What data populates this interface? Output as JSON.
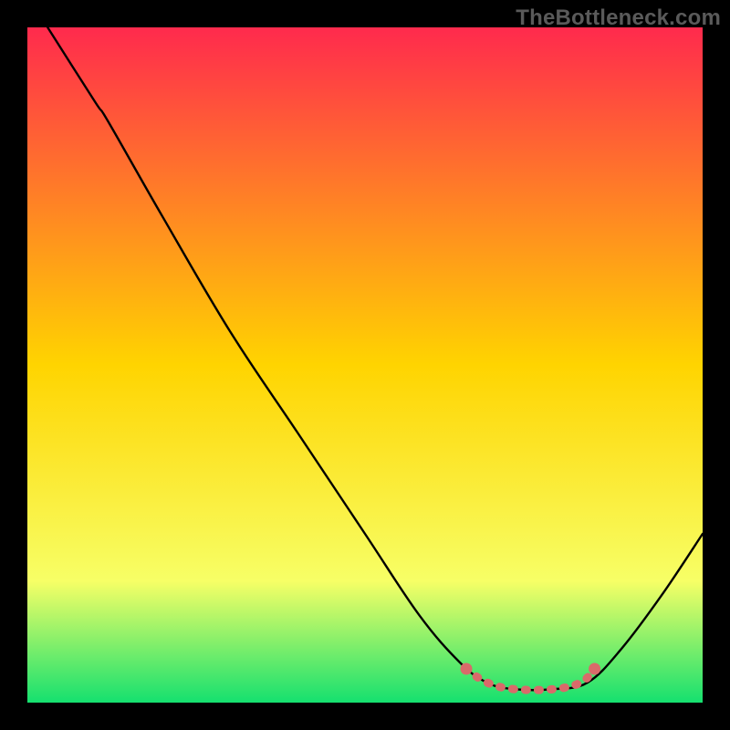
{
  "watermark": "TheBottleneck.com",
  "chart_data": {
    "type": "line",
    "title": "",
    "xlabel": "",
    "ylabel": "",
    "xlim": [
      0,
      100
    ],
    "ylim": [
      0,
      100
    ],
    "background_gradient": {
      "top_color": "#ff2a4d",
      "mid_color": "#ffd400",
      "low_color": "#f7ff66",
      "bottom_color": "#15e06f"
    },
    "series": [
      {
        "name": "bottleneck-curve",
        "color": "#000000",
        "points": [
          {
            "x": 3,
            "y": 100
          },
          {
            "x": 10,
            "y": 89
          },
          {
            "x": 12,
            "y": 86
          },
          {
            "x": 20,
            "y": 72
          },
          {
            "x": 30,
            "y": 55
          },
          {
            "x": 40,
            "y": 40
          },
          {
            "x": 50,
            "y": 25
          },
          {
            "x": 58,
            "y": 13
          },
          {
            "x": 64,
            "y": 6
          },
          {
            "x": 68,
            "y": 3
          },
          {
            "x": 72,
            "y": 2
          },
          {
            "x": 78,
            "y": 2
          },
          {
            "x": 83,
            "y": 3
          },
          {
            "x": 88,
            "y": 8
          },
          {
            "x": 94,
            "y": 16
          },
          {
            "x": 100,
            "y": 25
          }
        ]
      },
      {
        "name": "optimal-range-marker",
        "color": "#d96a6a",
        "points": [
          {
            "x": 65,
            "y": 5
          },
          {
            "x": 68,
            "y": 3
          },
          {
            "x": 72,
            "y": 2
          },
          {
            "x": 78,
            "y": 2
          },
          {
            "x": 82,
            "y": 3
          },
          {
            "x": 84,
            "y": 5
          }
        ]
      }
    ]
  }
}
